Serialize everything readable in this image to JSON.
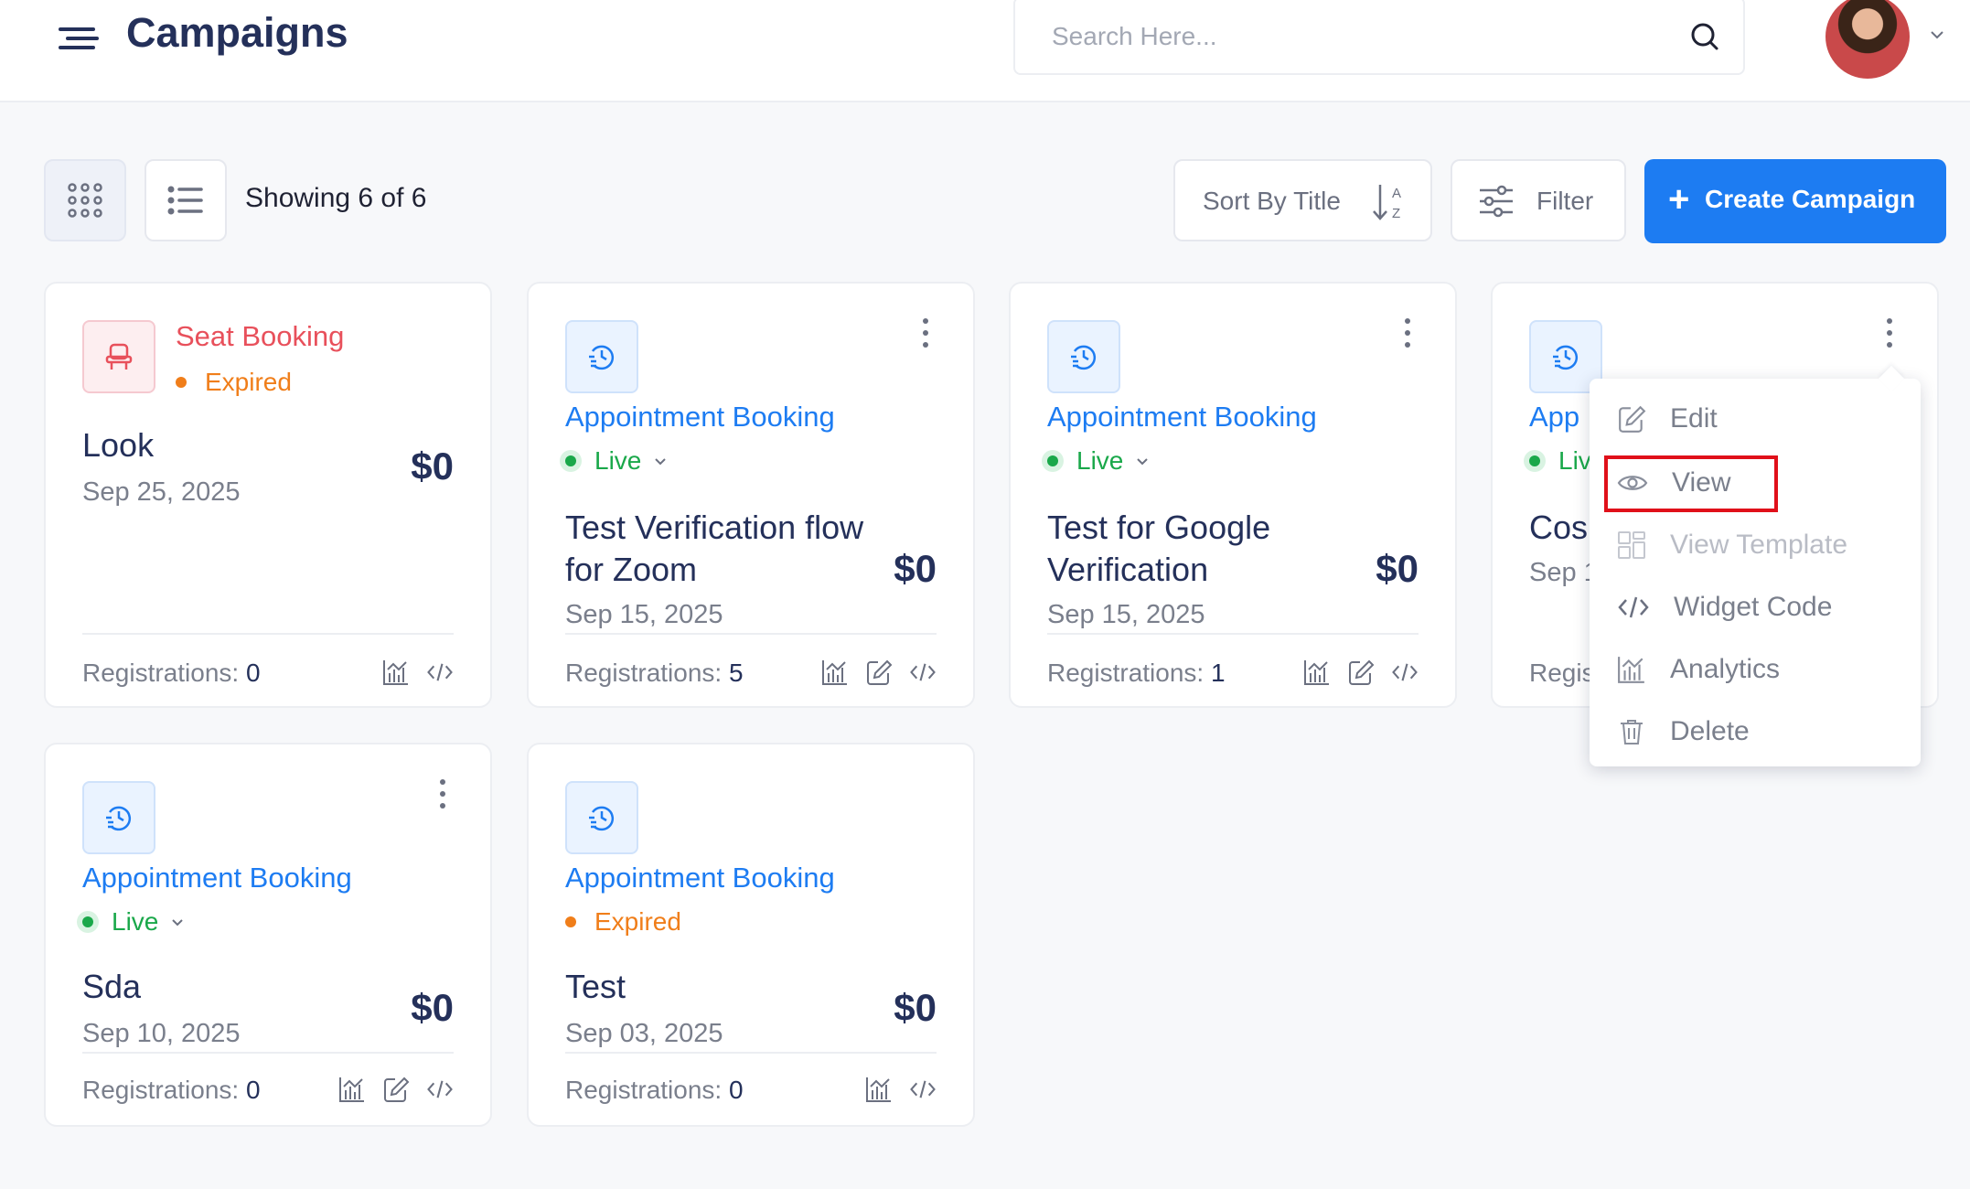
{
  "header": {
    "title": "Campaigns",
    "search_placeholder": "Search Here..."
  },
  "toolbar": {
    "showing": "Showing 6 of 6",
    "sort_label": "Sort By Title",
    "filter_label": "Filter",
    "create_label": "Create Campaign"
  },
  "cards": [
    {
      "type": "Seat Booking",
      "status": "Expired",
      "name": "Look",
      "date": "Sep 25, 2025",
      "price": "$0",
      "reg_label": "Registrations:",
      "reg_count": "0"
    },
    {
      "type": "Appointment Booking",
      "status": "Live",
      "name": "Test Verification flow for Zoom",
      "date": "Sep 15, 2025",
      "price": "$0",
      "reg_label": "Registrations:",
      "reg_count": "5"
    },
    {
      "type": "Appointment Booking",
      "status": "Live",
      "name": "Test for Google Verification",
      "date": "Sep 15, 2025",
      "price": "$0",
      "reg_label": "Registrations:",
      "reg_count": "1"
    },
    {
      "type_partial": "App",
      "status_partial": "Liv",
      "name_partial": "Cos",
      "date_partial": "Sep 1",
      "reg_partial": "Regis"
    },
    {
      "type": "Appointment Booking",
      "status": "Live",
      "name": "Sda",
      "date": "Sep 10, 2025",
      "price": "$0",
      "reg_label": "Registrations:",
      "reg_count": "0"
    },
    {
      "type": "Appointment Booking",
      "status": "Expired",
      "name": "Test",
      "date": "Sep 03, 2025",
      "price": "$0",
      "reg_label": "Registrations:",
      "reg_count": "0"
    }
  ],
  "menu": {
    "items": [
      "Edit",
      "View",
      "View Template",
      "Widget Code",
      "Analytics",
      "Delete"
    ]
  },
  "icons": [
    "hamburger-icon",
    "search-icon",
    "grid-view-icon",
    "list-view-icon",
    "sort-az-icon",
    "filter-sliders-icon",
    "plus-icon",
    "seat-icon",
    "clock-icon",
    "analytics-icon",
    "edit-icon",
    "code-icon",
    "eye-icon",
    "template-icon",
    "trash-icon",
    "kebab-icon"
  ],
  "colors": {
    "accent": "#1d7cf2",
    "live": "#1aa84a",
    "expired": "#f07e1a",
    "seat": "#e8505b",
    "highlight": "#e0101a"
  }
}
